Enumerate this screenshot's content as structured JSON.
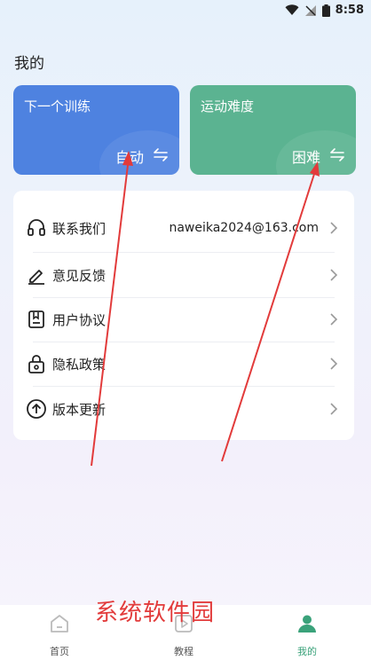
{
  "status": {
    "time": "8:58"
  },
  "page": {
    "title": "我的"
  },
  "cards": [
    {
      "title": "下一个训练",
      "value": "自动",
      "swap_glyph": "⇋",
      "color": "#4e82e0"
    },
    {
      "title": "运动难度",
      "value": "困难",
      "swap_glyph": "⇋",
      "color": "#5bb391"
    }
  ],
  "menu": [
    {
      "icon": "headset-icon",
      "label": "联系我们",
      "value": "naweika2024@163.com"
    },
    {
      "icon": "edit-icon",
      "label": "意见反馈",
      "value": ""
    },
    {
      "icon": "document-icon",
      "label": "用户协议",
      "value": ""
    },
    {
      "icon": "lock-icon",
      "label": "隐私政策",
      "value": ""
    },
    {
      "icon": "arrow-up-circle-icon",
      "label": "版本更新",
      "value": ""
    }
  ],
  "nav": [
    {
      "icon": "home-icon",
      "label": "首页",
      "active": false
    },
    {
      "icon": "play-icon",
      "label": "教程",
      "active": false
    },
    {
      "icon": "user-icon",
      "label": "我的",
      "active": true
    }
  ],
  "watermark": {
    "text": "系统软件园"
  },
  "colors": {
    "accent": "#3aa27a",
    "annotation_red": "#e23b3b"
  }
}
